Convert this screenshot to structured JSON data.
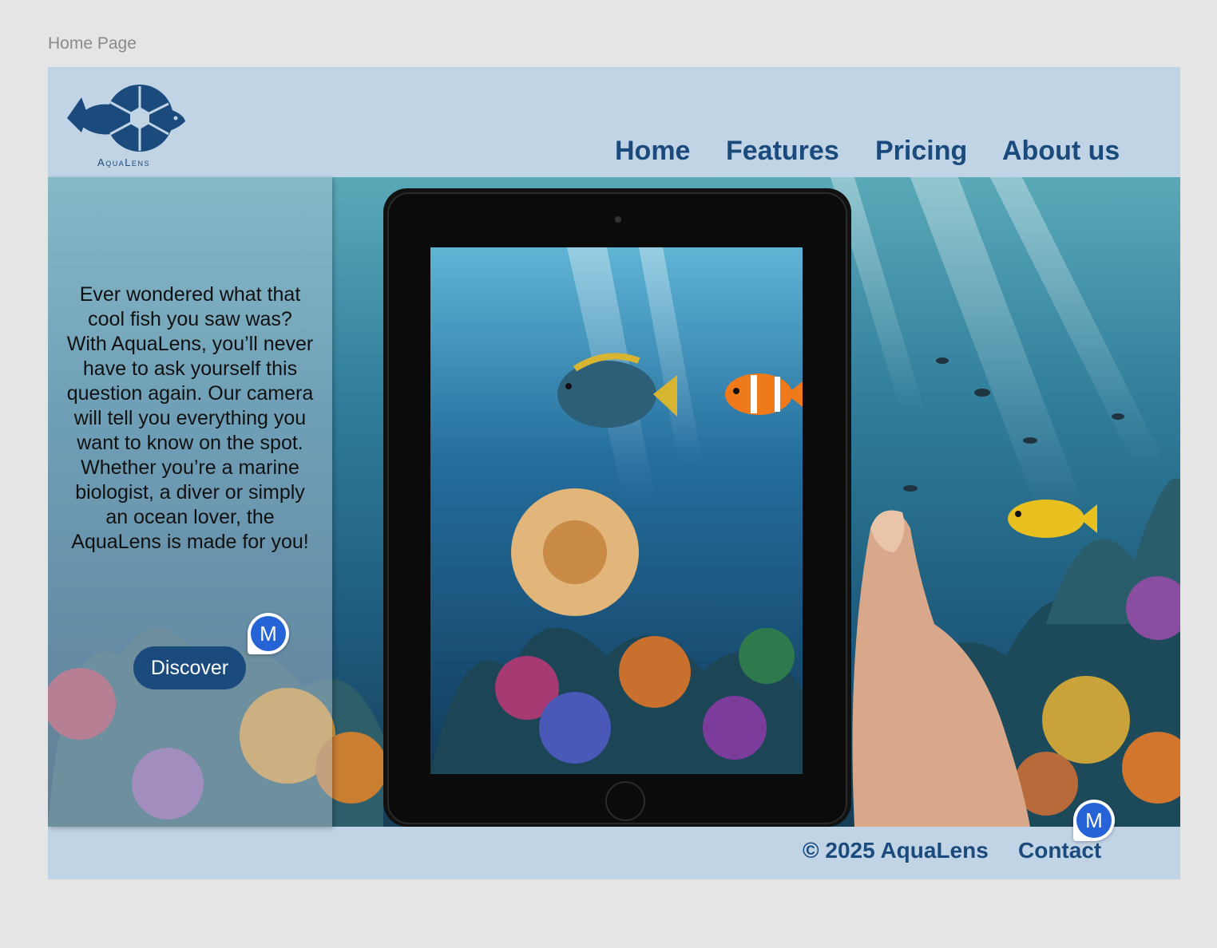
{
  "frame": {
    "label": "Home Page"
  },
  "brand": {
    "name": "AquaLens",
    "color": "#1b4a7c"
  },
  "nav": {
    "items": [
      {
        "label": "Home"
      },
      {
        "label": "Features"
      },
      {
        "label": "Pricing"
      },
      {
        "label": "About us"
      }
    ]
  },
  "hero": {
    "intro": "Ever wondered what that cool fish you saw was? With AquaLens, you’ll never have to ask yourself this question again. Our camera will tell you everything you want to know on the spot. Whether you’re a marine biologist, a diver or simply an ocean lover, the AquaLens is made for you!",
    "cta_label": "Discover",
    "image": "underwater-tablet-photo"
  },
  "footer": {
    "copyright": "© 2025 AquaLens",
    "contact": "Contact"
  },
  "collaborator": {
    "initial": "M",
    "color": "#2563d6"
  }
}
